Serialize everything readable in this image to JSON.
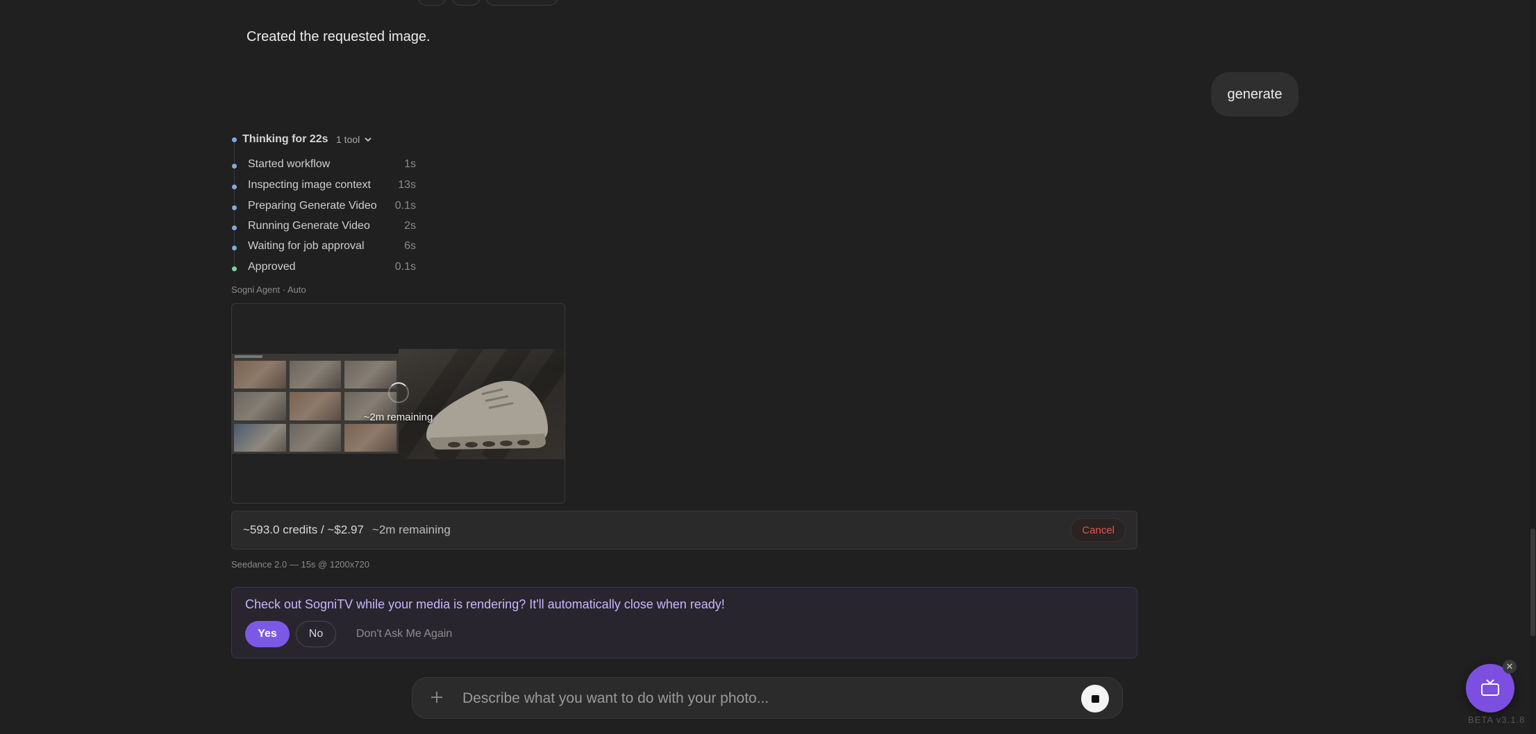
{
  "chat": {
    "assistant_message": "Created the requested image.",
    "user_message": "generate"
  },
  "thinking": {
    "title": "Thinking for 22s",
    "tool_count": "1 tool",
    "steps": [
      {
        "label": "Started workflow",
        "time": "1s",
        "status": "done"
      },
      {
        "label": "Inspecting image context",
        "time": "13s",
        "status": "done"
      },
      {
        "label": "Preparing Generate Video",
        "time": "0.1s",
        "status": "done"
      },
      {
        "label": "Running Generate Video",
        "time": "2s",
        "status": "done"
      },
      {
        "label": "Waiting for job approval",
        "time": "6s",
        "status": "done"
      },
      {
        "label": "Approved",
        "time": "0.1s",
        "status": "approved"
      }
    ]
  },
  "agent_label": "Sogni Agent · Auto",
  "preview": {
    "remaining_overlay": "~2m remaining"
  },
  "cost_bar": {
    "credits": "~593.0 credits / ~$2.97",
    "remaining": "~2m remaining",
    "cancel_label": "Cancel"
  },
  "model_meta": "Seedance 2.0 — 15s @ 1200x720",
  "tv_prompt": {
    "text": "Check out SogniTV while your media is rendering? It'll automatically close when ready!",
    "yes_label": "Yes",
    "no_label": "No",
    "dont_ask_label": "Don't Ask Me Again"
  },
  "composer": {
    "placeholder": "Describe what you want to do with your photo..."
  },
  "version": "BETA v3.1.8",
  "colors": {
    "background": "#202020",
    "accent_purple": "#7c58e6",
    "cancel_red": "#e0564f",
    "step_dot_blue": "#7fa9e0",
    "step_dot_green": "#7ed39a"
  },
  "icons": {
    "chevron": "chevron-down-icon",
    "plus": "plus-icon",
    "stop": "stop-icon",
    "tv": "tv-icon",
    "close": "close-icon"
  }
}
